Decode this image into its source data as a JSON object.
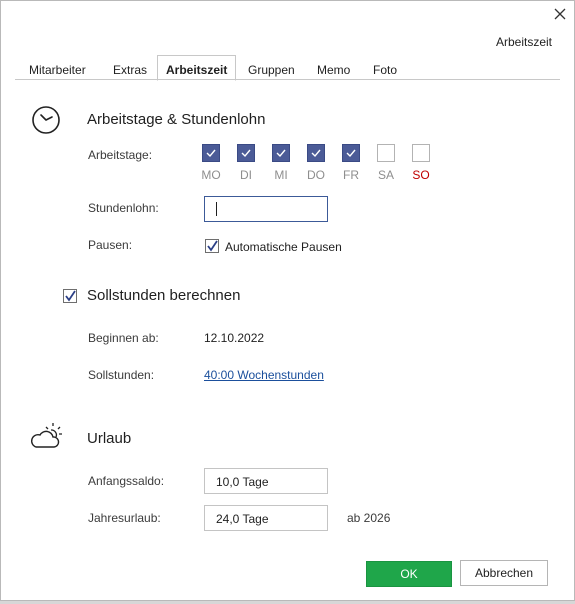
{
  "window": {
    "header_title": "Arbeitszeit",
    "close_icon": "close-icon"
  },
  "tabs": [
    {
      "label": "Mitarbeiter",
      "active": false
    },
    {
      "label": "Extras",
      "active": false
    },
    {
      "label": "Arbeitszeit",
      "active": true
    },
    {
      "label": "Gruppen",
      "active": false
    },
    {
      "label": "Memo",
      "active": false
    },
    {
      "label": "Foto",
      "active": false
    }
  ],
  "workdays_section": {
    "title": "Arbeitstage & Stundenlohn",
    "icon": "clock-icon",
    "arbeitstage_label": "Arbeitstage:",
    "days": [
      {
        "label": "MO",
        "checked": true
      },
      {
        "label": "DI",
        "checked": true
      },
      {
        "label": "MI",
        "checked": true
      },
      {
        "label": "DO",
        "checked": true
      },
      {
        "label": "FR",
        "checked": true
      },
      {
        "label": "SA",
        "checked": false
      },
      {
        "label": "SO",
        "checked": false
      }
    ],
    "stundenlohn_label": "Stundenlohn:",
    "stundenlohn_value": "",
    "pausen_label": "Pausen:",
    "auto_pausen_label": "Automatische Pausen",
    "auto_pausen_checked": true
  },
  "sollstunden_section": {
    "title": "Sollstunden berechnen",
    "checked": true,
    "beginnen_label": "Beginnen ab:",
    "beginnen_value": "12.10.2022",
    "sollstunden_label": "Sollstunden:",
    "sollstunden_link": "40:00 Wochenstunden"
  },
  "urlaub_section": {
    "title": "Urlaub",
    "icon": "weather-icon",
    "anfangssaldo_label": "Anfangssaldo:",
    "anfangssaldo_value": "10,0 Tage",
    "jahresurlaub_label": "Jahresurlaub:",
    "jahresurlaub_value": "24,0 Tage",
    "ab_label": "ab 2026"
  },
  "buttons": {
    "ok_label": "OK",
    "cancel_label": "Abbrechen"
  },
  "colors": {
    "ok_green": "#1fa64a",
    "checked_day": "#4b5b97",
    "link_blue": "#1b4f9c",
    "sunday_red": "#c00000"
  }
}
